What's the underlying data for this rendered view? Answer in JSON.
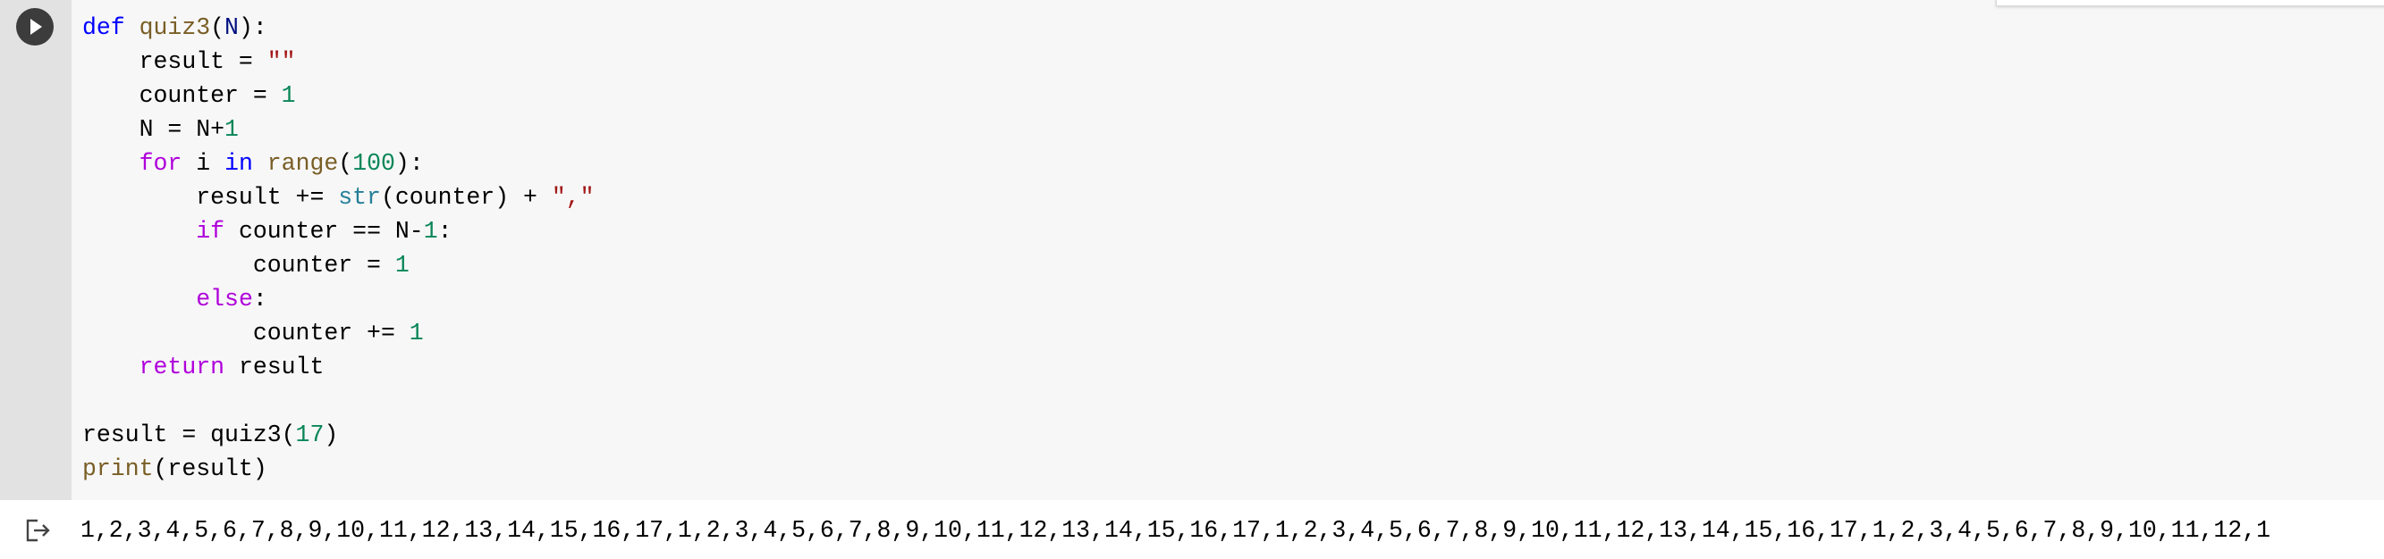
{
  "cell": {
    "run_button_label": "Run cell",
    "code_lines": [
      [
        {
          "t": "def",
          "c": "kw-def"
        },
        {
          "t": " "
        },
        {
          "t": "quiz3",
          "c": "fn-name"
        },
        {
          "t": "("
        },
        {
          "t": "N",
          "c": "param"
        },
        {
          "t": "):"
        }
      ],
      [
        {
          "t": "    result = "
        },
        {
          "t": "\"\"",
          "c": "str"
        }
      ],
      [
        {
          "t": "    counter = "
        },
        {
          "t": "1",
          "c": "num"
        }
      ],
      [
        {
          "t": "    N = N+"
        },
        {
          "t": "1",
          "c": "num"
        }
      ],
      [
        {
          "t": "    "
        },
        {
          "t": "for",
          "c": "kw-ctrl"
        },
        {
          "t": " i "
        },
        {
          "t": "in",
          "c": "kw-def"
        },
        {
          "t": " "
        },
        {
          "t": "range",
          "c": "fn-name"
        },
        {
          "t": "("
        },
        {
          "t": "100",
          "c": "num"
        },
        {
          "t": "):"
        }
      ],
      [
        {
          "t": "        result += "
        },
        {
          "t": "str",
          "c": "builtin"
        },
        {
          "t": "(counter) + "
        },
        {
          "t": "\",\"",
          "c": "str"
        }
      ],
      [
        {
          "t": "        "
        },
        {
          "t": "if",
          "c": "kw-ctrl"
        },
        {
          "t": " counter == N-"
        },
        {
          "t": "1",
          "c": "num"
        },
        {
          "t": ":"
        }
      ],
      [
        {
          "t": "            counter = "
        },
        {
          "t": "1",
          "c": "num"
        }
      ],
      [
        {
          "t": "        "
        },
        {
          "t": "else",
          "c": "kw-ctrl"
        },
        {
          "t": ":"
        }
      ],
      [
        {
          "t": "            counter += "
        },
        {
          "t": "1",
          "c": "num"
        }
      ],
      [
        {
          "t": "    "
        },
        {
          "t": "return",
          "c": "kw-ctrl"
        },
        {
          "t": " result"
        }
      ],
      [],
      [
        {
          "t": "result = quiz3("
        },
        {
          "t": "17",
          "c": "num"
        },
        {
          "t": ")"
        }
      ],
      [
        {
          "t": "print",
          "c": "fn-name"
        },
        {
          "t": "(result)"
        }
      ]
    ]
  },
  "output": {
    "icon": "output-redirect-icon",
    "text": "1,2,3,4,5,6,7,8,9,10,11,12,13,14,15,16,17,1,2,3,4,5,6,7,8,9,10,11,12,13,14,15,16,17,1,2,3,4,5,6,7,8,9,10,11,12,13,14,15,16,17,1,2,3,4,5,6,7,8,9,10,11,12,1"
  }
}
